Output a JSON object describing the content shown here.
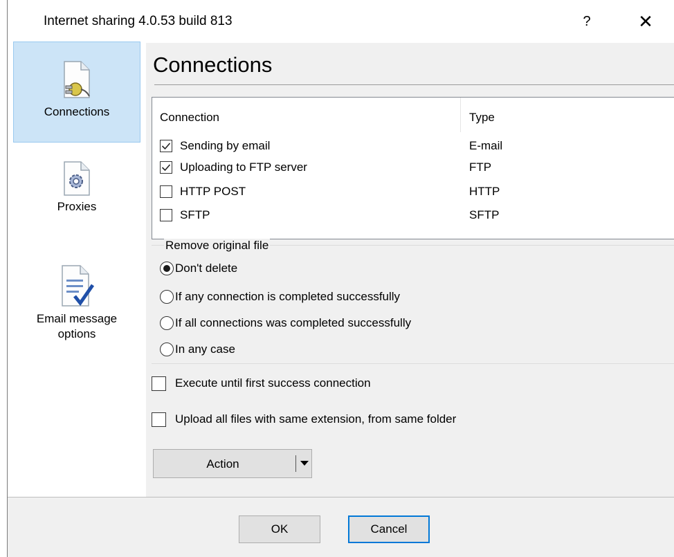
{
  "window": {
    "title": "Internet sharing 4.0.53 build 813",
    "help_glyph": "?",
    "close_glyph": "✕"
  },
  "sidebar": {
    "items": [
      {
        "label": "Connections",
        "icon": "plug-icon",
        "selected": true
      },
      {
        "label": "Proxies",
        "icon": "gear-icon",
        "selected": false
      },
      {
        "label": "Email message options",
        "label_line1": "Email message",
        "label_line2": "options",
        "icon": "email-options-icon",
        "selected": false
      }
    ]
  },
  "main": {
    "title": "Connections",
    "list": {
      "columns": [
        "Connection",
        "Type"
      ],
      "rows": [
        {
          "name": "Sending by email",
          "type": "E-mail",
          "checked": true
        },
        {
          "name": "Uploading to FTP server",
          "type": "FTP",
          "checked": true
        },
        {
          "name": "HTTP POST",
          "type": "HTTP",
          "checked": false
        },
        {
          "name": "SFTP",
          "type": "SFTP",
          "checked": false
        }
      ]
    },
    "remove_group": {
      "legend": "Remove original file",
      "options": [
        {
          "label": "Don't delete",
          "selected": true
        },
        {
          "label": "If any connection is completed successfully",
          "selected": false
        },
        {
          "label": "If all connections was completed successfully",
          "selected": false
        },
        {
          "label": "In any case",
          "selected": false
        }
      ]
    },
    "execute_until_first": {
      "label": "Execute until first success connection",
      "checked": false
    },
    "upload_all_files": {
      "label": "Upload all files with same extension, from same folder",
      "checked": false
    },
    "action_button": {
      "label": "Action"
    }
  },
  "footer": {
    "ok_label": "OK",
    "cancel_label": "Cancel"
  },
  "colors": {
    "selection_bg": "#cce4f7",
    "default_button_border": "#0078d7"
  }
}
